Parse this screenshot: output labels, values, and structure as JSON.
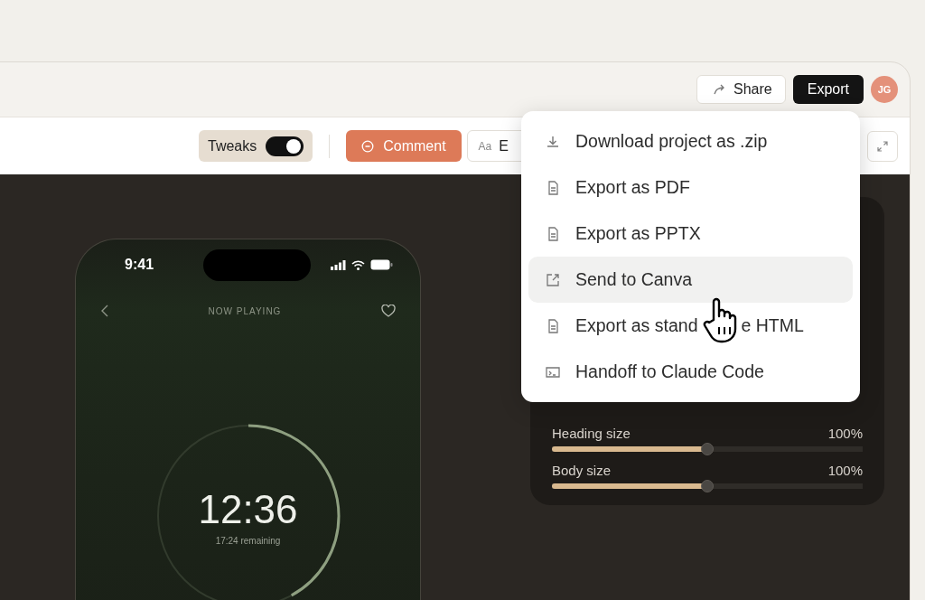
{
  "header": {
    "share": "Share",
    "export": "Export",
    "avatar": "JG"
  },
  "toolbar": {
    "tweaks": {
      "label": "Tweaks",
      "on": true
    },
    "comment": "Comment",
    "edit": {
      "prefix": "Aa",
      "label": "E"
    }
  },
  "export_menu": [
    {
      "kind": "download",
      "label": "Download project as .zip",
      "selected": false
    },
    {
      "kind": "file",
      "label": "Export as PDF",
      "selected": false
    },
    {
      "kind": "file",
      "label": "Export as PPTX",
      "selected": false
    },
    {
      "kind": "external",
      "label": "Send to Canva",
      "selected": true
    },
    {
      "kind": "file",
      "label": "Export as stand",
      "label_tail": "e HTML",
      "selected": false
    },
    {
      "kind": "terminal",
      "label": "Handoff to Claude Code",
      "selected": false
    }
  ],
  "phone": {
    "time": "9:41",
    "title": "NOW PLAYING",
    "timer": {
      "elapsed": "12:36",
      "remaining": "17:24 remaining",
      "level": 0.42
    }
  },
  "tweaks_panel": {
    "sliders": [
      {
        "label": "Heading size",
        "value": "100%",
        "level": 0.5
      },
      {
        "label": "Body size",
        "value": "100%",
        "level": 0.5
      }
    ]
  }
}
